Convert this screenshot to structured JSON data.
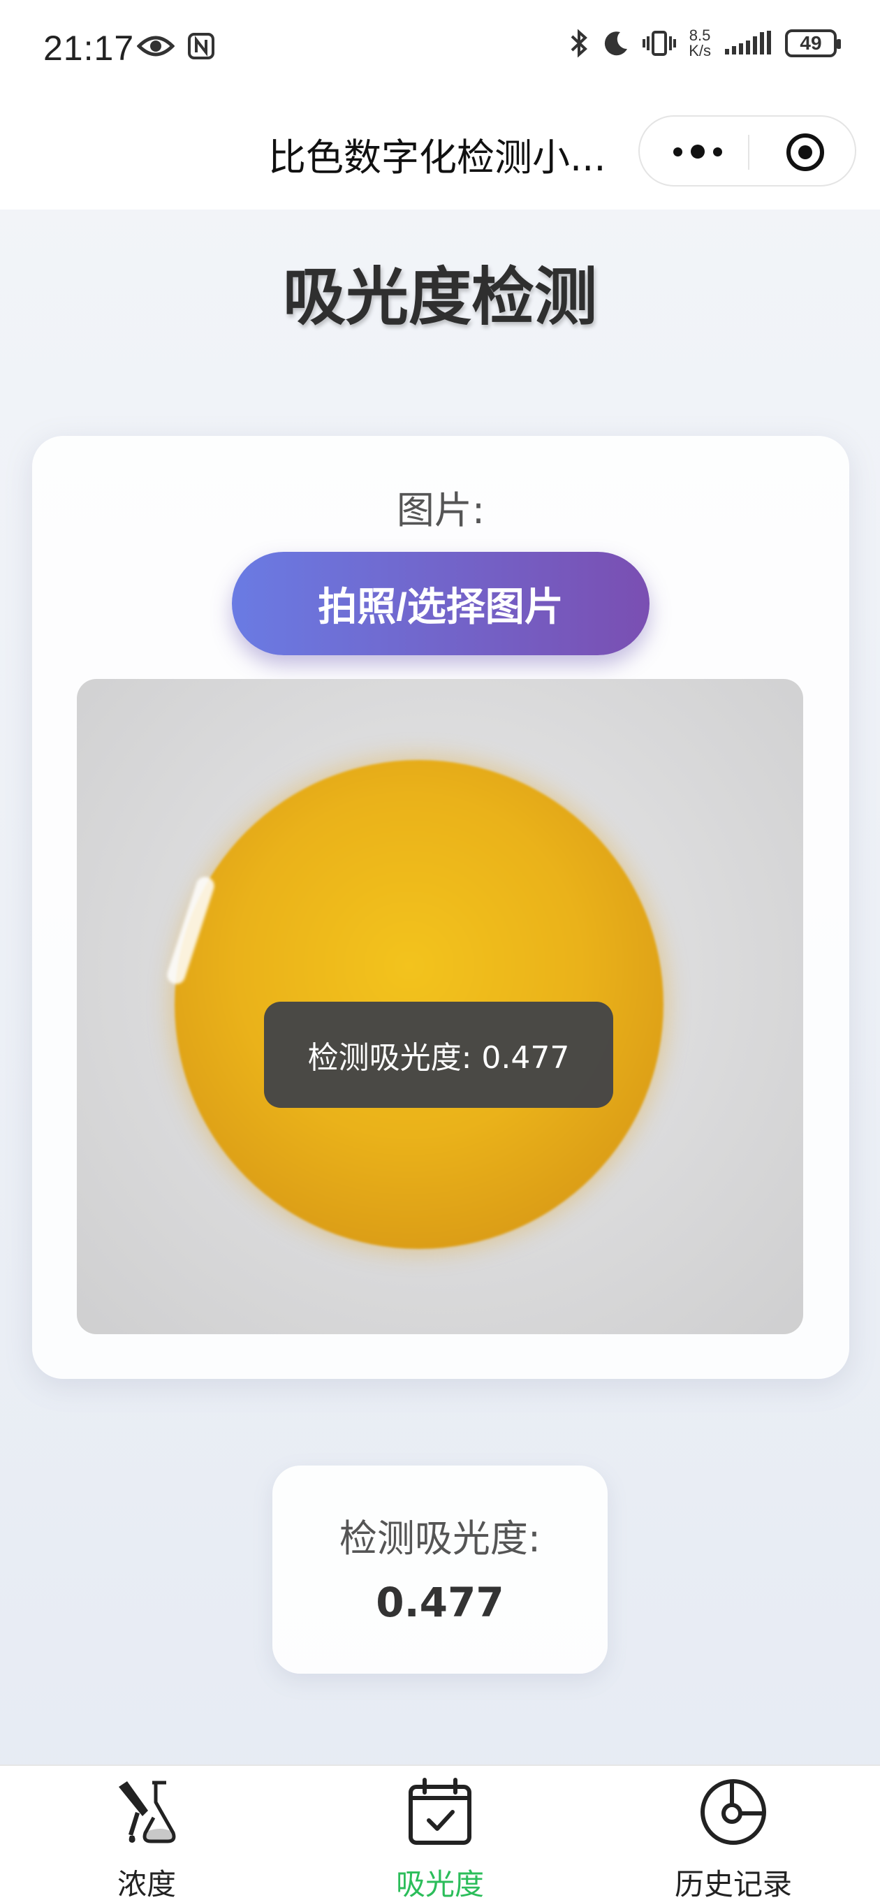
{
  "status_bar": {
    "time": "21:17",
    "net_speed_value": "8.5",
    "net_speed_unit": "K/s",
    "battery": "49"
  },
  "nav": {
    "title": "比色数字化检测小..."
  },
  "page": {
    "title": "吸光度检测"
  },
  "card": {
    "image_label": "图片:",
    "choose_button": "拍照/选择图片",
    "toast": "检测吸光度: 0.477"
  },
  "result": {
    "label": "检测吸光度:",
    "value": "0.477"
  },
  "tab_bar": {
    "items": [
      {
        "label": "浓度",
        "icon": "flask-dropper-icon",
        "active": false
      },
      {
        "label": "吸光度",
        "icon": "calendar-check-icon",
        "active": true
      },
      {
        "label": "历史记录",
        "icon": "history-dial-icon",
        "active": false
      }
    ]
  },
  "colors": {
    "accent_green": "#2bbd5a",
    "button_gradient_start": "#6a7be3",
    "button_gradient_end": "#7a4fb2"
  }
}
